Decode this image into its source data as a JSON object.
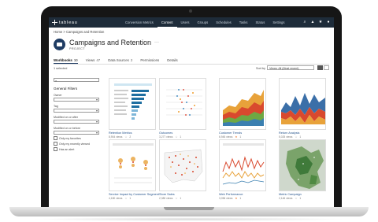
{
  "nav": {
    "logo": "tableau",
    "links": [
      "Conversion Metrics",
      "Content",
      "Users",
      "Groups",
      "Schedules",
      "Tasks",
      "Status",
      "Settings"
    ],
    "active": "Content"
  },
  "breadcrumb": "Home > Campaigns and Retention",
  "project": {
    "title": "Campaigns and Retention",
    "type": "PROJECT"
  },
  "tabs": [
    {
      "label": "Workbooks",
      "count": "10",
      "active": true
    },
    {
      "label": "Views",
      "count": "47"
    },
    {
      "label": "Data Sources",
      "count": "2"
    },
    {
      "label": "Permissions",
      "count": ""
    },
    {
      "label": "Details",
      "count": ""
    }
  ],
  "toolbar": {
    "selected": "1 selected",
    "sort_label": "Sort by",
    "sort_value": "Views: All (Most recent)"
  },
  "filters": {
    "heading": "General Filters",
    "fields": [
      "Owner",
      "Tag",
      "Modified on or after",
      "Modified on or before"
    ],
    "checks": [
      "Only my favorites",
      "Only my recently viewed",
      "Has an alert"
    ]
  },
  "cards": [
    {
      "title": "Retention Metrics",
      "views": "8,904 views",
      "favs": "2"
    },
    {
      "title": "Outcomes",
      "views": "3,277 views",
      "favs": "1"
    },
    {
      "title": "Customer Trends",
      "views": "6,945 views",
      "favs": "1"
    },
    {
      "title": "Return Analysis",
      "views": "5,025 views",
      "favs": "1"
    },
    {
      "title": "Service Impact by Customer Segment",
      "views": "4,180 views",
      "favs": "1"
    },
    {
      "title": "Store Sales",
      "views": "2,380 views",
      "favs": "1"
    },
    {
      "title": "Web Performance",
      "views": "3,056 views",
      "favs": "1"
    },
    {
      "title": "Metric Campaign",
      "views": "2,146 views",
      "favs": "1"
    }
  ],
  "colors": {
    "nav_bg": "#1e2c3a",
    "accent": "#1f3c63",
    "link": "#1f4f8a",
    "star": "#e8762d"
  }
}
